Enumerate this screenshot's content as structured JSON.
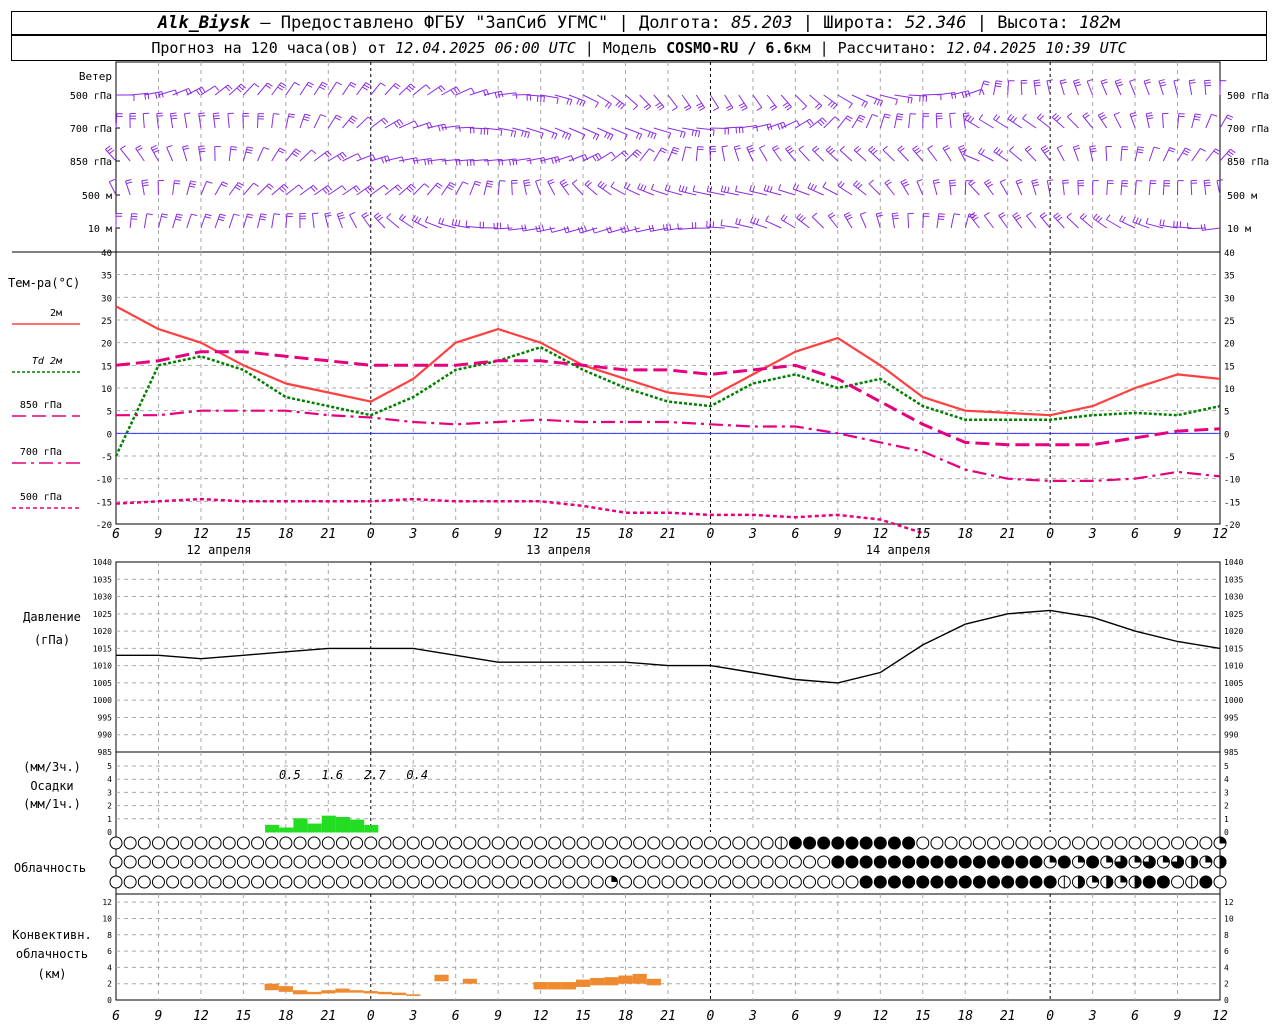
{
  "header": {
    "station": "Alk_Biysk",
    "dash": " — ",
    "provider": "Предоставлено ФГБУ \"ЗапСиб УГМС\"",
    "sep": " | ",
    "lon_label": "Долгота: ",
    "lon_value": "85.203",
    "lat_label": "Широта: ",
    "lat_value": "52.346",
    "alt_label": "Высота: ",
    "alt_value": "182",
    "alt_unit": "м",
    "forecast_label": "Прогноз на 120 часа(ов) от ",
    "forecast_from": "12.04.2025 06:00 UTC",
    "model_label": " | Модель ",
    "model_name": "COSMO-RU / 6.6",
    "model_unit": "км",
    "calc_label": " | Рассчитано: ",
    "calc_time": "12.04.2025 10:39 UTC"
  },
  "colors": {
    "wind": "#8a2be2",
    "t2m": "#ff4040",
    "td2m": "#008000",
    "t850": "#e6007e",
    "t700": "#e6007e",
    "t500": "#e6007e",
    "zero_line": "#3030ff",
    "precip": "#22dd22",
    "conv": "#f08a30",
    "grid": "#aaaaaa"
  },
  "chart_data": [
    {
      "type": "wind-barbs",
      "title": "Ветер",
      "levels": [
        "500 гПа",
        "700 гПа",
        "850 гПа",
        "500 м",
        "10 м"
      ]
    },
    {
      "type": "line",
      "ylabel": "Тем-ра(°C)",
      "ylim": [
        -20,
        40
      ],
      "yticks": [
        40,
        35,
        30,
        25,
        20,
        15,
        10,
        5,
        0,
        -5,
        -10,
        -15,
        -20
      ],
      "x": [
        6,
        9,
        12,
        15,
        18,
        21,
        0,
        3,
        6,
        9,
        12,
        15,
        18,
        21,
        0,
        3,
        6,
        9,
        12,
        15,
        18,
        21,
        0,
        3,
        6,
        9,
        12
      ],
      "date_labels": [
        "12 апреля",
        "13 апреля",
        "14 апреля"
      ],
      "series": [
        {
          "name": "2м",
          "key": "t2m",
          "values": [
            28,
            23,
            20,
            15,
            11,
            9,
            7,
            12,
            20,
            23,
            20,
            15,
            12,
            9,
            8,
            13,
            18,
            21,
            15,
            8,
            5,
            4.5,
            4,
            6,
            10,
            13,
            12
          ]
        },
        {
          "name": "Td  2м",
          "key": "td2m",
          "values": [
            -5,
            15,
            17,
            14,
            8,
            6,
            4,
            8,
            14,
            16,
            19,
            14,
            10,
            7,
            6,
            11,
            13,
            10,
            12,
            6,
            3,
            3,
            3,
            4,
            4.5,
            4,
            6
          ]
        },
        {
          "name": "850 гПа",
          "key": "t850",
          "values": [
            15,
            16,
            18,
            18,
            17,
            16,
            15,
            15,
            15,
            16,
            16,
            15,
            14,
            14,
            13,
            14,
            15,
            12,
            7,
            2,
            -2,
            -2.5,
            -2.5,
            -2.5,
            -1,
            0.5,
            1
          ]
        },
        {
          "name": "700 гПа",
          "key": "t700",
          "values": [
            4,
            4,
            5,
            5,
            5,
            4,
            3.5,
            2.5,
            2,
            2.5,
            3,
            2.5,
            2.5,
            2.5,
            2,
            1.5,
            1.5,
            0,
            -2,
            -4,
            -8,
            -10,
            -10.5,
            -10.5,
            -10,
            -8.5,
            -9.5
          ]
        },
        {
          "name": "500 гПа",
          "key": "t500",
          "values": [
            -15.5,
            -15,
            -14.5,
            -15,
            -15,
            -15,
            -15,
            -14.5,
            -15,
            -15,
            -15,
            -16,
            -17.5,
            -17.5,
            -18,
            -18,
            -18.5,
            -18,
            -19,
            -22,
            null,
            null,
            null,
            null,
            null,
            null,
            null
          ]
        }
      ]
    },
    {
      "type": "line",
      "ylabel": "Давление",
      "ylabel2": "(гПа)",
      "ylim": [
        985,
        1040
      ],
      "yticks": [
        1040,
        1035,
        1030,
        1025,
        1020,
        1015,
        1010,
        1005,
        1000,
        995,
        990,
        985
      ],
      "x": [
        6,
        9,
        12,
        15,
        18,
        21,
        0,
        3,
        6,
        9,
        12,
        15,
        18,
        21,
        0,
        3,
        6,
        9,
        12,
        15,
        18,
        21,
        0,
        3,
        6,
        9,
        12
      ],
      "series": [
        {
          "name": "pressure",
          "values": [
            1013,
            1013,
            1012,
            1013,
            1014,
            1015,
            1015,
            1015,
            1013,
            1011,
            1011,
            1011,
            1011,
            1010,
            1010,
            1008,
            1006,
            1005,
            1008,
            1016,
            1022,
            1025,
            1026,
            1024,
            1020,
            1017,
            1015
          ]
        }
      ]
    },
    {
      "type": "bar",
      "ylabel_a": "(мм/3ч.)",
      "ylabel_b": "Осадки",
      "ylabel_c": "(мм/1ч.)",
      "ylim": [
        0,
        5
      ],
      "yticks": [
        5,
        4,
        3,
        2,
        1,
        0
      ],
      "hourly_start_hour": 11,
      "hourly_values": [
        0.5,
        0.3,
        1.0,
        0.6,
        1.2,
        1.1,
        0.9,
        0.5
      ],
      "three_hour_labels": [
        "0.5",
        "1.6",
        "2.7",
        "0.4"
      ]
    },
    {
      "type": "table",
      "ylabel": "Облачность",
      "rows": [
        "00000000000000000000000000000000000000000000000CFFFFFFFFF0000000000000000000002B2B2B2BT",
        "000000000000000000000000000000000000000000000000000FFFFFFFFFFFFFFF2F2F2B2B2BT2T2T",
        "00000000000000000000000000000000000Q00000000000000000FFFFFFFFFFFFFFHT2T2TFF0HF0FFF0000"
      ]
    },
    {
      "type": "bar",
      "ylabel_a": "Конвективн.",
      "ylabel_b": "облачность",
      "ylabel_c": "(км)",
      "ylim": [
        0,
        13
      ],
      "yticks": [
        12,
        10,
        8,
        6,
        4,
        2,
        0
      ],
      "hourly_start_hour": 11,
      "segments": [
        {
          "h": 11,
          "bottom": 1.2,
          "top": 2.0
        },
        {
          "h": 12,
          "bottom": 1.0,
          "top": 1.7
        },
        {
          "h": 13,
          "bottom": 0.7,
          "top": 1.2
        },
        {
          "h": 14,
          "bottom": 0.7,
          "top": 1.0
        },
        {
          "h": 15,
          "bottom": 0.8,
          "top": 1.2
        },
        {
          "h": 16,
          "bottom": 0.9,
          "top": 1.4
        },
        {
          "h": 17,
          "bottom": 0.9,
          "top": 1.2
        },
        {
          "h": 18,
          "bottom": 0.8,
          "top": 1.1
        },
        {
          "h": 19,
          "bottom": 0.7,
          "top": 1.0
        },
        {
          "h": 20,
          "bottom": 0.6,
          "top": 0.9
        },
        {
          "h": 21,
          "bottom": 0.5,
          "top": 0.7
        },
        {
          "h": 23,
          "bottom": 2.3,
          "top": 3.1
        },
        {
          "h": 25,
          "bottom": 2.0,
          "top": 2.6
        },
        {
          "h": 30,
          "bottom": 1.3,
          "top": 2.2
        },
        {
          "h": 31,
          "bottom": 1.3,
          "top": 2.2
        },
        {
          "h": 32,
          "bottom": 1.3,
          "top": 2.2
        },
        {
          "h": 33,
          "bottom": 1.6,
          "top": 2.5
        },
        {
          "h": 34,
          "bottom": 1.8,
          "top": 2.7
        },
        {
          "h": 35,
          "bottom": 1.8,
          "top": 2.8
        },
        {
          "h": 36,
          "bottom": 2.0,
          "top": 3.0
        },
        {
          "h": 37,
          "bottom": 2.0,
          "top": 3.2
        },
        {
          "h": 38,
          "bottom": 1.8,
          "top": 2.6
        }
      ]
    }
  ]
}
